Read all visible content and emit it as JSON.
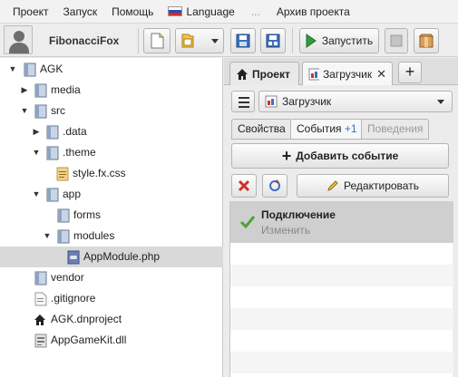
{
  "menubar": {
    "items": [
      "Проект",
      "Запуск",
      "Помощь",
      "Language",
      "...",
      "Архив проекта"
    ]
  },
  "toolbar": {
    "username": "FibonacciFox",
    "run_label": "Запустить"
  },
  "tree": {
    "nodes": [
      {
        "label": "AGK",
        "expanded": true,
        "icon": "project-folder-icon"
      },
      {
        "label": "media",
        "expanded": false,
        "icon": "folder-icon"
      },
      {
        "label": "src",
        "expanded": true,
        "icon": "folder-icon"
      },
      {
        "label": ".data",
        "expanded": false,
        "icon": "folder-icon"
      },
      {
        "label": ".theme",
        "expanded": true,
        "icon": "folder-icon"
      },
      {
        "label": "style.fx.css",
        "icon": "css-file-icon"
      },
      {
        "label": "app",
        "expanded": true,
        "icon": "folder-icon"
      },
      {
        "label": "forms",
        "icon": "folder-icon"
      },
      {
        "label": "modules",
        "expanded": true,
        "icon": "folder-icon"
      },
      {
        "label": "AppModule.php",
        "icon": "php-file-icon",
        "selected": true
      },
      {
        "label": "vendor",
        "icon": "folder-icon"
      },
      {
        "label": ".gitignore",
        "icon": "text-file-icon"
      },
      {
        "label": "AGK.dnproject",
        "icon": "home-icon"
      },
      {
        "label": "AppGameKit.dll",
        "icon": "dll-file-icon"
      }
    ]
  },
  "panel": {
    "tabs": {
      "project": "Проект",
      "loader": "Загрузчик"
    },
    "component_select": "Загрузчик",
    "subtabs": {
      "properties": "Свойства",
      "events": "События",
      "events_count": "+1",
      "behaviours": "Поведения"
    },
    "add_event": "Добавить событие",
    "edit": "Редактировать",
    "events": [
      {
        "title": "Подключение",
        "subtitle": "Изменить"
      }
    ]
  },
  "colors": {
    "selection": "#d9d9d9",
    "event_highlight": "#cfcfcf",
    "count_blue": "#3a6fc4",
    "run_green": "#2e9e3a",
    "delete_red": "#d0302a"
  }
}
